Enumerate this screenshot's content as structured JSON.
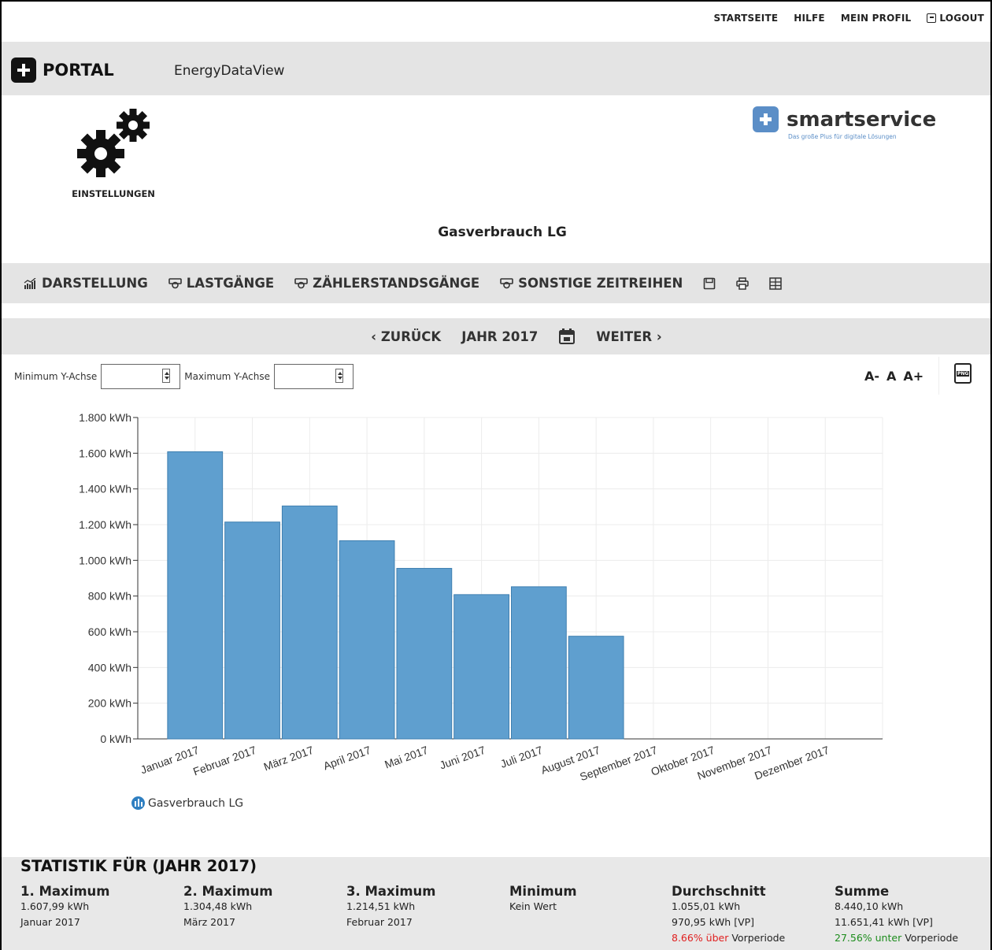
{
  "topnav": {
    "home": "STARTSEITE",
    "help": "HILFE",
    "profile": "MEIN PROFIL",
    "logout": "LOGOUT"
  },
  "portal": {
    "logo_text": "PORTAL",
    "app_name": "EnergyDataView"
  },
  "settings": {
    "label": "EINSTELLUNGEN"
  },
  "brand": {
    "name": "smartservice",
    "tagline": "Das große Plus für digitale Lösungen",
    "color": "#5b8ec7"
  },
  "page_title": "Gasverbrauch LG",
  "toolbar": {
    "darstellung": "DARSTELLUNG",
    "lastgaenge": "LASTGÄNGE",
    "zaehlerstandsgaenge": "ZÄHLERSTANDSGÄNGE",
    "sonstige": "SONSTIGE ZEITREIHEN"
  },
  "period": {
    "back": "‹ ZURÜCK",
    "current": "JAHR 2017",
    "next": "WEITER ›"
  },
  "yaxis_controls": {
    "min_label": "Minimum Y-Achse",
    "max_label": "Maximum Y-Achse",
    "min_value": "",
    "max_value": ""
  },
  "font_controls": {
    "smaller": "A-",
    "normal": "A",
    "larger": "A+"
  },
  "png_label": "PNG",
  "chart_data": {
    "type": "bar",
    "categories": [
      "Januar 2017",
      "Februar 2017",
      "März 2017",
      "April 2017",
      "Mai 2017",
      "Juni 2017",
      "Juli 2017",
      "August 2017",
      "September 2017",
      "Oktober 2017",
      "November 2017",
      "Dezember 2017"
    ],
    "series": [
      {
        "name": "Gasverbrauch LG",
        "values": [
          1607.99,
          1214.51,
          1304.48,
          1110,
          955,
          808,
          852,
          575,
          null,
          null,
          null,
          null
        ],
        "color": "#5f9fcf"
      }
    ],
    "ylim": [
      0,
      1800
    ],
    "yticks": [
      "0 kWh",
      "200 kWh",
      "400 kWh",
      "600 kWh",
      "800 kWh",
      "1.000 kWh",
      "1.200 kWh",
      "1.400 kWh",
      "1.600 kWh",
      "1.800 kWh"
    ],
    "grid": true,
    "legend": "bottom-left"
  },
  "stats": {
    "title": "STATISTIK FÜR (JAHR 2017)",
    "cols": [
      {
        "head": "1. Maximum",
        "l1": "1.607,99 kWh",
        "l2": "Januar 2017"
      },
      {
        "head": "2. Maximum",
        "l1": "1.304,48 kWh",
        "l2": "März 2017"
      },
      {
        "head": "3. Maximum",
        "l1": "1.214,51 kWh",
        "l2": "Februar 2017"
      },
      {
        "head": "Minimum",
        "l1": "Kein Wert"
      },
      {
        "head": "Durchschnitt",
        "l1": "1.055,01 kWh",
        "l2": "970,95 kWh [VP]",
        "pct": "8.66% über",
        "rest": " Vorperiode"
      },
      {
        "head": "Summe",
        "l1": "8.440,10 kWh",
        "l2": "11.651,41 kWh [VP]",
        "pct": "27.56% unter",
        "rest": " Vorperiode"
      }
    ]
  }
}
